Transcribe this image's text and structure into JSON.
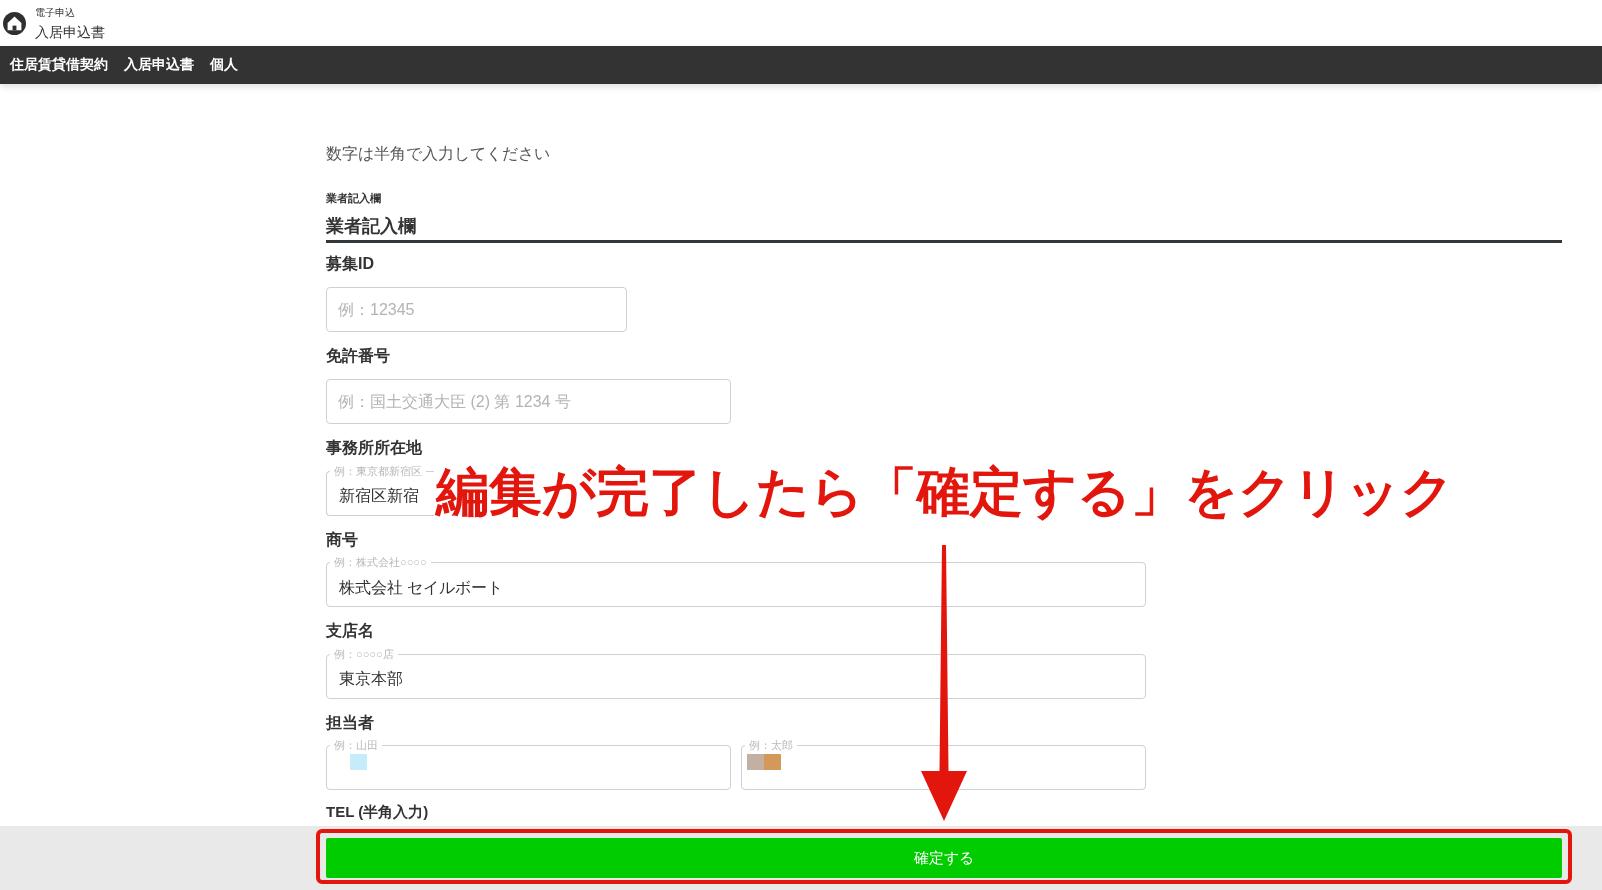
{
  "header": {
    "caption": "電子申込",
    "title": "入居申込書"
  },
  "breadcrumb": [
    {
      "label": "住居賃貸借契約"
    },
    {
      "label": "入居申込書"
    },
    {
      "label": "個人"
    }
  ],
  "form": {
    "note": "数字は半角で入力してください",
    "section_caption": "業者記入欄",
    "section_title": "業者記入欄",
    "fields": [
      {
        "kind": "plain",
        "label": "募集ID",
        "inputs": [
          {
            "placeholder": "例：12345"
          }
        ]
      },
      {
        "kind": "plain",
        "label": "免許番号",
        "inputs": [
          {
            "placeholder": "例：国土交通大臣 (2) 第 1234 号"
          }
        ]
      },
      {
        "kind": "outlined",
        "label": "事務所所在地",
        "inputs": [
          {
            "floating_label": "例：東京都新宿区",
            "value": "新宿区新宿"
          }
        ]
      },
      {
        "kind": "outlined",
        "label": "商号",
        "inputs": [
          {
            "floating_label": "例：株式会社○○○○",
            "value": "株式会社 セイルボート"
          }
        ]
      },
      {
        "kind": "outlined",
        "label": "支店名",
        "inputs": [
          {
            "floating_label": "例：○○○○店",
            "value": "東京本部"
          }
        ]
      },
      {
        "kind": "outlined",
        "label": "担当者",
        "inputs": [
          {
            "floating_label": "例：山田",
            "mosaic": [
              {
                "color": "#c6ebfb"
              }
            ]
          },
          {
            "floating_label": "例：太郎",
            "mosaic": [
              {
                "color": "#c2b1a2"
              },
              {
                "color": "#d3985a"
              }
            ]
          }
        ]
      },
      {
        "kind": "partial",
        "label": "TEL (半角入力)"
      }
    ]
  },
  "callout": {
    "text": "編集が完了したら「確定する」をクリック"
  },
  "footer": {
    "confirm_button": "確定する"
  }
}
